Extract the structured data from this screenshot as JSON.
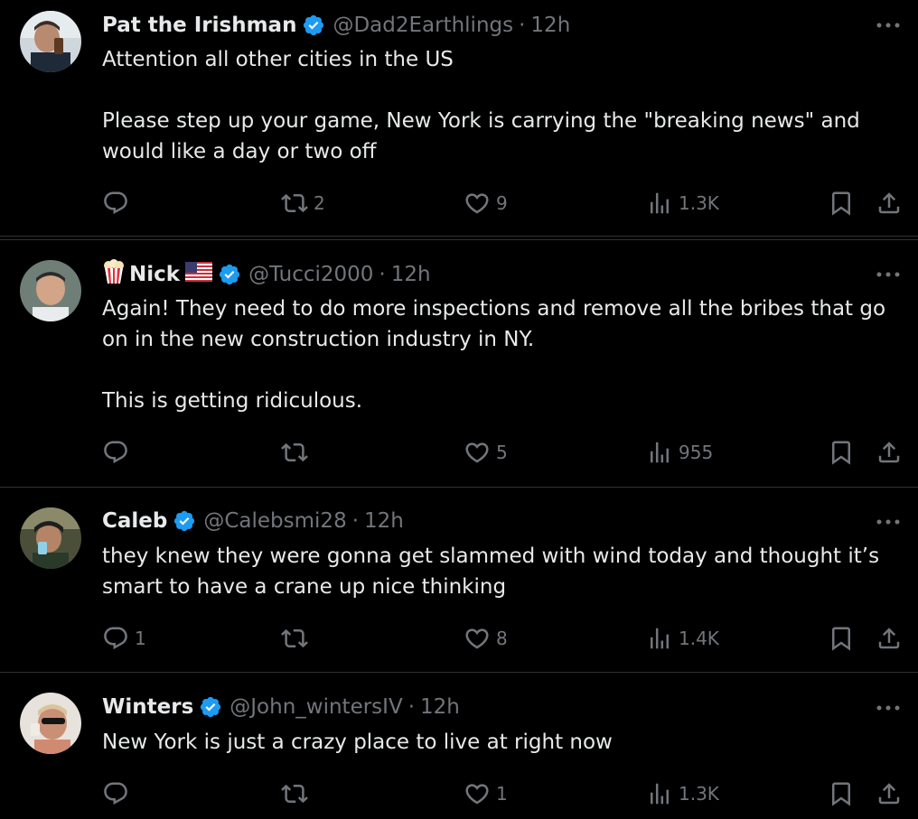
{
  "tweets": [
    {
      "name": "Pat the Irishman",
      "handle": "@Dad2Earthlings",
      "dot": "·",
      "time": "12h",
      "lines": [
        "Attention all other cities in the US",
        "",
        "Please step up your game, New York is carrying the \"breaking news\" and",
        "would like a day or two off"
      ],
      "reply_count": "",
      "retweet_count": "2",
      "like_count": "9",
      "views": "1.3K",
      "avatar": "man-drinking-avatar"
    },
    {
      "name": "Nick",
      "handle": "@Tucci2000",
      "dot": "·",
      "time": "12h",
      "lines": [
        "Again! They need to do more inspections and remove all the bribes that go",
        "on in the new construction industry in NY.",
        "",
        "This is getting ridiculous."
      ],
      "reply_count": "",
      "retweet_count": "",
      "like_count": "5",
      "views": "955",
      "avatar": "man-portrait-avatar",
      "name_prefix_icon": "popcorn-icon",
      "name_suffix_icon": "us-flag-icon"
    },
    {
      "name": "Caleb",
      "handle": "@Calebsmi28",
      "dot": "·",
      "time": "12h",
      "lines": [
        "they knew they were gonna get slammed with wind today and thought it’s",
        "smart to have a crane up nice thinking"
      ],
      "reply_count": "1",
      "retweet_count": "",
      "like_count": "8",
      "views": "1.4K",
      "avatar": "man-selfie-avatar"
    },
    {
      "name": "Winters",
      "handle": "@John_wintersIV",
      "dot": "·",
      "time": "12h",
      "lines": [
        "New York is just a crazy place to live at right now"
      ],
      "reply_count": "",
      "retweet_count": "",
      "like_count": "1",
      "views": "1.3K",
      "avatar": "man-sunglasses-avatar"
    }
  ],
  "colors": {
    "background": "#000000",
    "text": "#e7e9ea",
    "muted": "#71767b",
    "verified": "#1d9bf0",
    "divider": "#2f3336"
  }
}
